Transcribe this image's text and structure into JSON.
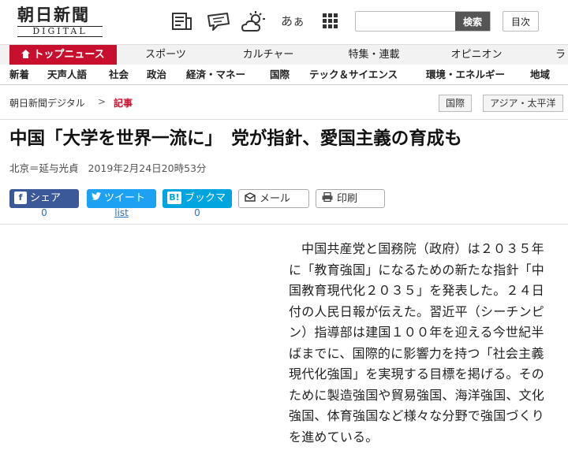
{
  "header": {
    "logo_jp": "朝日新聞",
    "logo_en": "DIGITAL",
    "search_placeholder": "",
    "search_button": "検索",
    "index_button": "目次",
    "icons": [
      "newspaper-icon",
      "comment-icon",
      "weather-icon",
      "font-size-icon",
      "menu-grid-icon"
    ],
    "font_icon_text": "あぁ"
  },
  "mainnav": {
    "items": [
      "トップニュース",
      "スポーツ",
      "カルチャー",
      "特集・連載",
      "オピニオン",
      "ラ"
    ]
  },
  "subnav": {
    "items": [
      "新着",
      "天声人語",
      "社会",
      "政治",
      "経済・マネー",
      "国際",
      "テック＆サイエンス",
      "環境・エネルギー",
      "地域"
    ]
  },
  "breadcrumb": {
    "home": "朝日新聞デジタル",
    "separator": ">",
    "current": "記事",
    "tags": [
      "国際",
      "アジア・太平洋"
    ]
  },
  "article": {
    "title": "中国「大学を世界一流に」　党が指針、愛国主義の育成も",
    "author": "北京＝延与光貞",
    "date": "2019年2月24日20時53分",
    "share": {
      "facebook_label": "シェア",
      "facebook_count": "0",
      "twitter_label": "ツイート",
      "twitter_count": "list",
      "hatena_label": "ブックマー",
      "hatena_count": "0",
      "mail_label": "メール",
      "print_label": "印刷"
    },
    "body": "中国共産党と国務院（政府）は２０３５年に「教育強国」になるための新たな指針「中国教育現代化２０３５」を発表した。２４日付の人民日報が伝えた。習近平（シーチンピン）指導部は建国１００年を迎える今世紀半ばまでに、国際的に影響力を持つ「社会主義現代化強国」を実現する目標を掲げる。そのために製造強国や貿易強国、海洋強国、文化強国、体育強国など様々な分野で強国づくりを進めている。"
  },
  "colors": {
    "brand_red": "#c8102e",
    "facebook": "#3b5998",
    "twitter": "#1da1f2",
    "hatena": "#00a4de"
  }
}
